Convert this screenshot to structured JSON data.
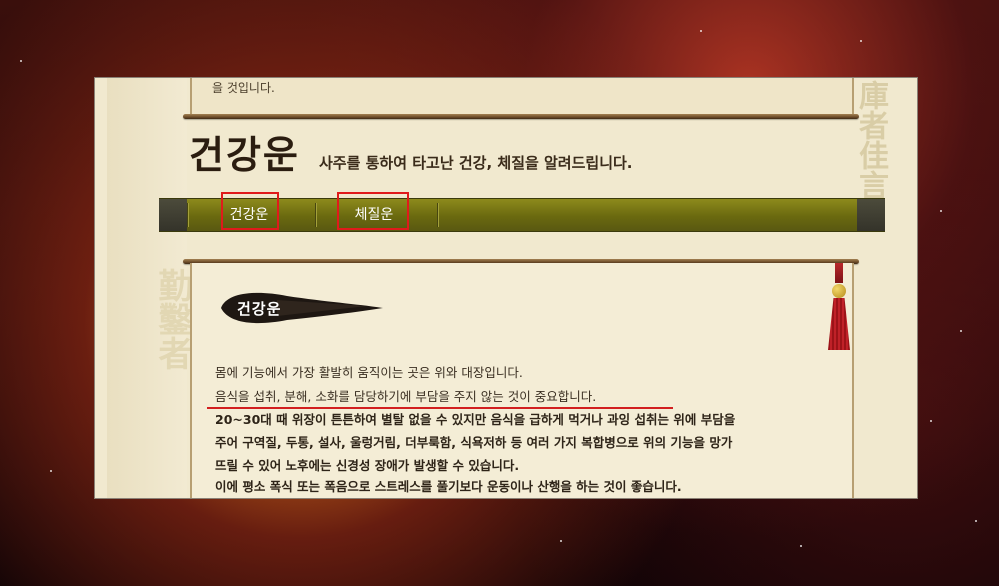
{
  "page": {
    "top_cut_text": "을 것입니다.",
    "title": "건강운",
    "subtitle": "사주를 통하여 타고난 건강, 체질을 알려드립니다."
  },
  "nav": {
    "tabs": [
      {
        "label": "건강운"
      },
      {
        "label": "체질운"
      }
    ]
  },
  "section": {
    "label": "건강운",
    "paragraph_lines": [
      "몸에 기능에서 가장 활발히 움직이는 곳은 위와 대장입니다.",
      "음식을 섭취, 분해, 소화를 담당하기에 부담을 주지 않는 것이 중요합니다.",
      "20~30대 때 위장이 튼튼하여 별탈 없을 수 있지만 음식을 급하게 먹거나 과잉 섭취는 위에 부담을",
      "주어 구역질, 두통, 설사, 울렁거림, 더부룩함, 식욕저하 등 여러 가지 복합병으로 위의 기능을 망가",
      "뜨릴 수 있어 노후에는 신경성 장애가 발생할 수 있습니다.",
      "이에 평소 폭식 또는 폭음으로 스트레스를 풀기보다 운동이나 산행을 하는 것이 좋습니다."
    ]
  },
  "decor": {
    "bg_glyphs_left": "勤鑿者",
    "bg_glyphs_right": "庫者佳言"
  },
  "colors": {
    "nav_olive": "#6a690f",
    "highlight_red": "#e01b1b",
    "parchment": "#f1e9cf"
  }
}
